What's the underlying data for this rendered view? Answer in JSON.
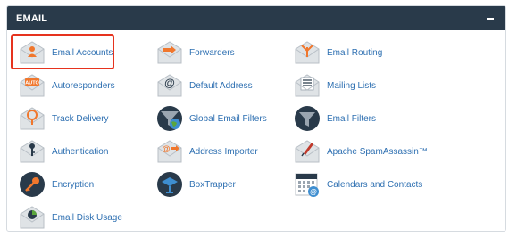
{
  "panel": {
    "title": "EMAIL"
  },
  "items": [
    {
      "key": "email-accounts",
      "label": "Email Accounts",
      "icon": "envelope-user-icon"
    },
    {
      "key": "forwarders",
      "label": "Forwarders",
      "icon": "envelope-arrow-icon"
    },
    {
      "key": "email-routing",
      "label": "Email Routing",
      "icon": "envelope-routing-icon"
    },
    {
      "key": "autoresponders",
      "label": "Autoresponders",
      "icon": "envelope-auto-icon"
    },
    {
      "key": "default-address",
      "label": "Default Address",
      "icon": "envelope-at-icon"
    },
    {
      "key": "mailing-lists",
      "label": "Mailing Lists",
      "icon": "envelope-list-icon"
    },
    {
      "key": "track-delivery",
      "label": "Track Delivery",
      "icon": "envelope-pin-icon"
    },
    {
      "key": "global-email-filters",
      "label": "Global Email Filters",
      "icon": "globe-filter-icon"
    },
    {
      "key": "email-filters",
      "label": "Email Filters",
      "icon": "funnel-filter-icon"
    },
    {
      "key": "authentication",
      "label": "Authentication",
      "icon": "envelope-key-icon"
    },
    {
      "key": "address-importer",
      "label": "Address Importer",
      "icon": "envelope-import-icon"
    },
    {
      "key": "apache-spamassassin",
      "label": "Apache SpamAssassin™",
      "icon": "envelope-spam-icon"
    },
    {
      "key": "encryption",
      "label": "Encryption",
      "icon": "encryption-key-icon"
    },
    {
      "key": "boxtrapper",
      "label": "BoxTrapper",
      "icon": "boxtrapper-icon"
    },
    {
      "key": "calendars-and-contacts",
      "label": "Calendars and Contacts",
      "icon": "calendar-contacts-icon"
    },
    {
      "key": "email-disk-usage",
      "label": "Email Disk Usage",
      "icon": "envelope-pie-icon"
    }
  ],
  "colors": {
    "header_bg": "#293a4a",
    "link": "#2d6fb1",
    "highlight": "#e6331e",
    "envelope": "#dfe3e6",
    "accent_orange": "#f0772d",
    "navy": "#293a4a"
  }
}
